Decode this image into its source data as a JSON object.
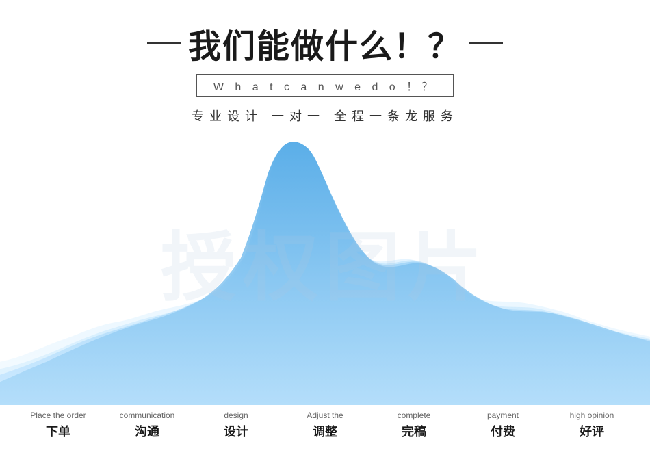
{
  "header": {
    "main_title": "我们能做什么！？",
    "subtitle": "W h a t  c a n  w e  d o ！？",
    "description": "专业设计  一对一  全程一条龙服务"
  },
  "watermark": "授权图片",
  "steps": [
    {
      "en": "Place the order",
      "zh": "下单"
    },
    {
      "en": "communication",
      "zh": "沟通"
    },
    {
      "en": "design",
      "zh": "设计"
    },
    {
      "en": "Adjust the",
      "zh": "调整"
    },
    {
      "en": "complete",
      "zh": "完稿"
    },
    {
      "en": "payment",
      "zh": "付费"
    },
    {
      "en": "high opinion",
      "zh": "好评"
    }
  ],
  "colors": {
    "wave1": "rgba(100,170,230,0.9)",
    "wave2": "rgba(120,185,240,0.75)",
    "wave3": "rgba(150,205,250,0.6)",
    "wave4": "rgba(180,220,255,0.45)"
  }
}
